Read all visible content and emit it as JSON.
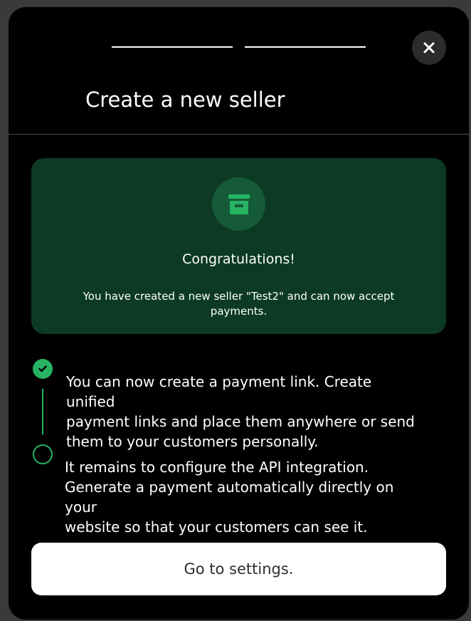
{
  "modal": {
    "title": "Create a new seller",
    "close_icon": "close-icon",
    "stepper_steps": 2
  },
  "success_card": {
    "icon": "store-icon",
    "heading": "Congratulations!",
    "message_line1": "You have created a new seller \"Test2\" and can now accept",
    "message_line2": "payments."
  },
  "steps": [
    {
      "status": "done",
      "icon": "check-icon",
      "lines": [
        "You can now create a payment link. Create unified",
        "payment links and place them anywhere or send",
        "them to your customers personally."
      ]
    },
    {
      "status": "pending",
      "icon": "empty-circle-icon",
      "lines": [
        "It remains to configure the API integration.",
        "Generate a payment automatically directly on your",
        "website so that your customers can see it."
      ]
    }
  ],
  "actions": {
    "settings_label": "Go to settings."
  },
  "colors": {
    "modal_bg": "#000000",
    "card_bg": "#0c3a25",
    "icon_bg": "#155b38",
    "accent": "#26b362",
    "button_bg": "#ffffff"
  }
}
